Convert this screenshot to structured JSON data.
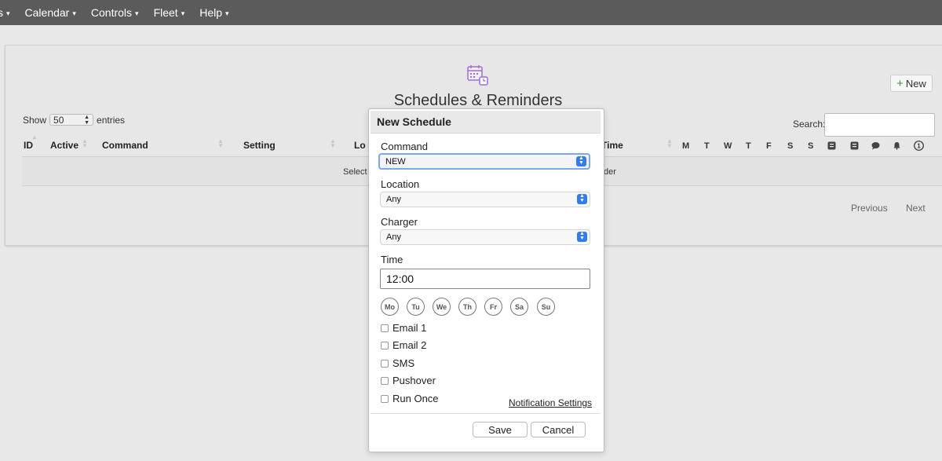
{
  "nav": {
    "items": [
      {
        "label": "s"
      },
      {
        "label": "Calendar"
      },
      {
        "label": "Controls"
      },
      {
        "label": "Fleet"
      },
      {
        "label": "Help"
      }
    ]
  },
  "page": {
    "title": "Schedules & Reminders",
    "new_button": "New",
    "show_label": "Show",
    "entries_value": "50",
    "entries_label": "entries",
    "search_label": "Search:"
  },
  "table": {
    "columns": {
      "id": "ID",
      "active": "Active",
      "command": "Command",
      "setting": "Setting",
      "location_partial": "Lo",
      "time_partial": "Time"
    },
    "day_columns": [
      "M",
      "T",
      "W",
      "T",
      "F",
      "S",
      "S"
    ],
    "empty_left": "Select",
    "empty_right": "der"
  },
  "pagination": {
    "previous": "Previous",
    "next": "Next"
  },
  "modal": {
    "title": "New Schedule",
    "command": {
      "label": "Command",
      "value": "NEW"
    },
    "location": {
      "label": "Location",
      "value": "Any"
    },
    "charger": {
      "label": "Charger",
      "value": "Any"
    },
    "time": {
      "label": "Time",
      "value": "12:00"
    },
    "days": [
      "Mo",
      "Tu",
      "We",
      "Th",
      "Fr",
      "Sa",
      "Su"
    ],
    "checkboxes": [
      "Email 1",
      "Email 2",
      "SMS",
      "Pushover",
      "Run Once"
    ],
    "notification_link": "Notification Settings",
    "save": "Save",
    "cancel": "Cancel"
  },
  "colors": {
    "nav_bg": "#5b5b5b",
    "accent_blue": "#2f7cf6",
    "plus_green": "#3a9a3a",
    "icon_purple": "#9b6fd8"
  }
}
